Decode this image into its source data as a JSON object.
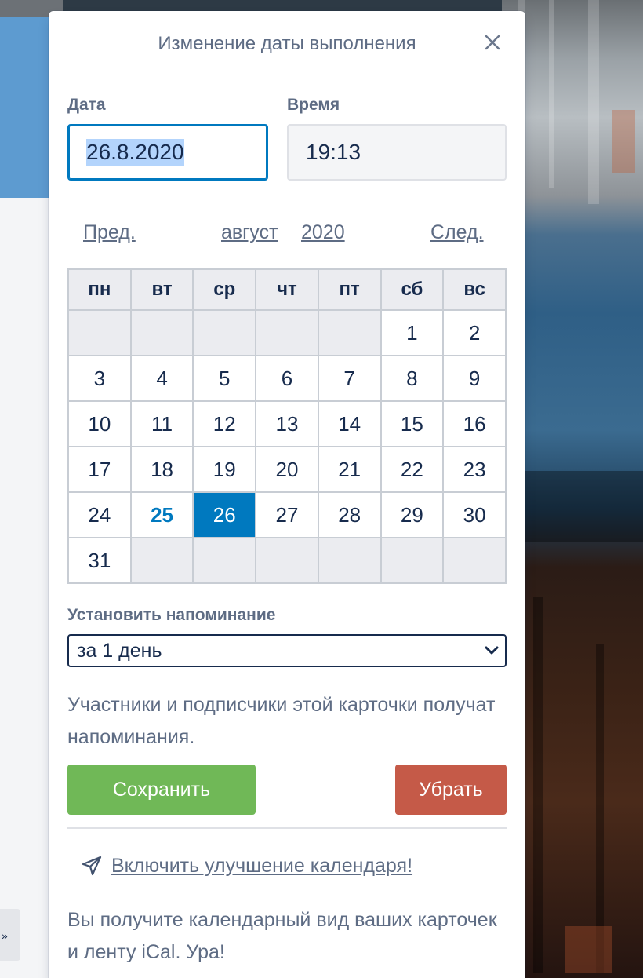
{
  "background": {
    "stub_glyph": "»"
  },
  "popover": {
    "title": "Изменение даты выполнения",
    "close_icon": "close-icon"
  },
  "date": {
    "label": "Дата",
    "value": "26.8.2020"
  },
  "time": {
    "label": "Время",
    "value": "19:13"
  },
  "calendar": {
    "prev": "Пред.",
    "month": "август",
    "year": "2020",
    "next": "След.",
    "weekdays": [
      "пн",
      "вт",
      "ср",
      "чт",
      "пт",
      "сб",
      "вс"
    ],
    "weeks": [
      [
        "",
        "",
        "",
        "",
        "",
        "1",
        "2"
      ],
      [
        "3",
        "4",
        "5",
        "6",
        "7",
        "8",
        "9"
      ],
      [
        "10",
        "11",
        "12",
        "13",
        "14",
        "15",
        "16"
      ],
      [
        "17",
        "18",
        "19",
        "20",
        "21",
        "22",
        "23"
      ],
      [
        "24",
        "25",
        "26",
        "27",
        "28",
        "29",
        "30"
      ],
      [
        "31",
        "",
        "",
        "",
        "",
        "",
        ""
      ]
    ],
    "today": "25",
    "selected": "26"
  },
  "reminder": {
    "label": "Установить напоминание",
    "selected": "за 1 день",
    "note": "Участники и подписчики этой карточки получат напоминания."
  },
  "buttons": {
    "save": "Сохранить",
    "remove": "Убрать"
  },
  "colors": {
    "accent": "#0079bf",
    "save": "#70b857",
    "remove": "#c55a48"
  },
  "upgrade": {
    "icon": "rocket-icon",
    "link": "Включить улучшение календаря!",
    "note": "Вы получите календарный вид ваших карточек и ленту iCal. Ура!"
  }
}
